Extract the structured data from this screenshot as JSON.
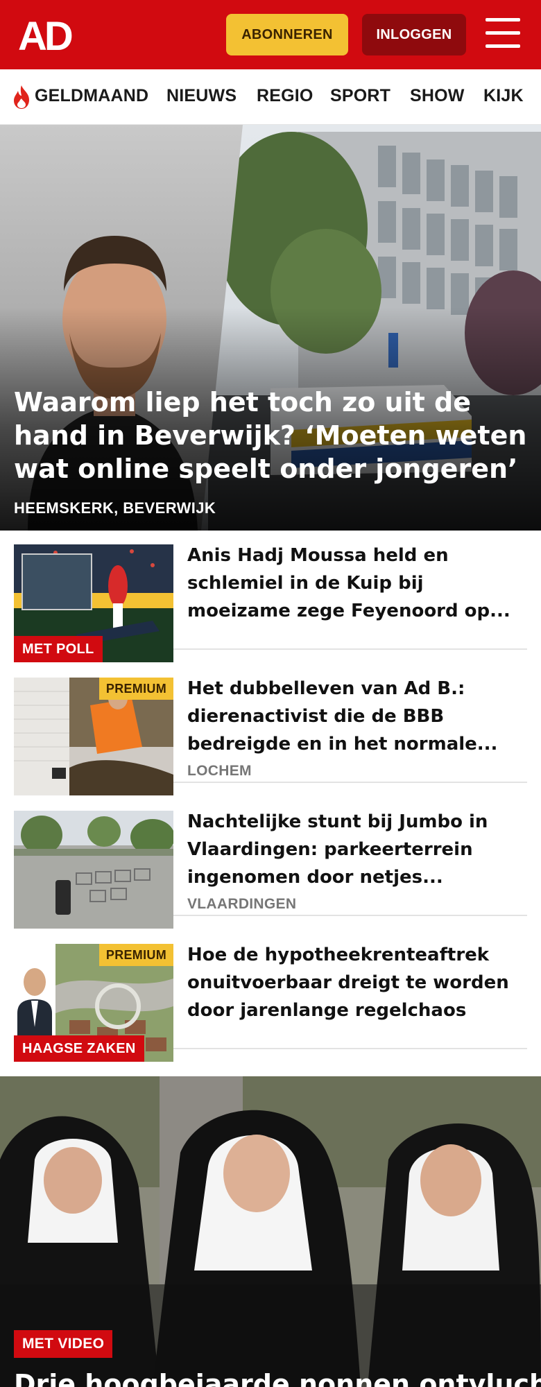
{
  "header": {
    "logo": "AD",
    "subscribe_label": "ABONNEREN",
    "login_label": "INLOGGEN",
    "menu_icon": "hamburger-menu-icon",
    "brand_color": "#d10a10",
    "accent_color": "#f3c133"
  },
  "nav": {
    "items": [
      {
        "label": "GELDMAAND",
        "icon": "flame-icon"
      },
      {
        "label": "NIEUWS"
      },
      {
        "label": "REGIO"
      },
      {
        "label": "SPORT"
      },
      {
        "label": "SHOW"
      },
      {
        "label": "KIJK"
      }
    ]
  },
  "hero": {
    "title": "Waarom liep het toch zo uit de hand in Beverwijk? ‘Moeten weten wat online speelt onder jongeren’",
    "location": "HEEMSKERK, BEVERWIJK"
  },
  "articles": [
    {
      "title": "Anis Hadj Moussa held en schlemiel in de Kuip bij moeizame zege Feyenoord op...",
      "tag": "MET POLL",
      "premium": "",
      "location": ""
    },
    {
      "title": "Het dubbelleven van Ad B.: dierenactivist die de BBB bedreigde en in het normale...",
      "tag": "",
      "premium": "PREMIUM",
      "location": "LOCHEM"
    },
    {
      "title": "Nachtelijke stunt bij Jumbo in Vlaardingen: parkeerterrein ingenomen door netjes...",
      "tag": "",
      "premium": "",
      "location": "VLAARDINGEN"
    },
    {
      "title": "Hoe de hypotheekrenteaftrek onuitvoerbaar dreigt te worden door jarenlange regelchaos",
      "tag": "HAAGSE ZAKEN",
      "premium": "PREMIUM",
      "location": ""
    }
  ],
  "hero2": {
    "tag": "MET VIDEO",
    "title": "Drie hoogbejaarde nonnen ontvluch-"
  }
}
